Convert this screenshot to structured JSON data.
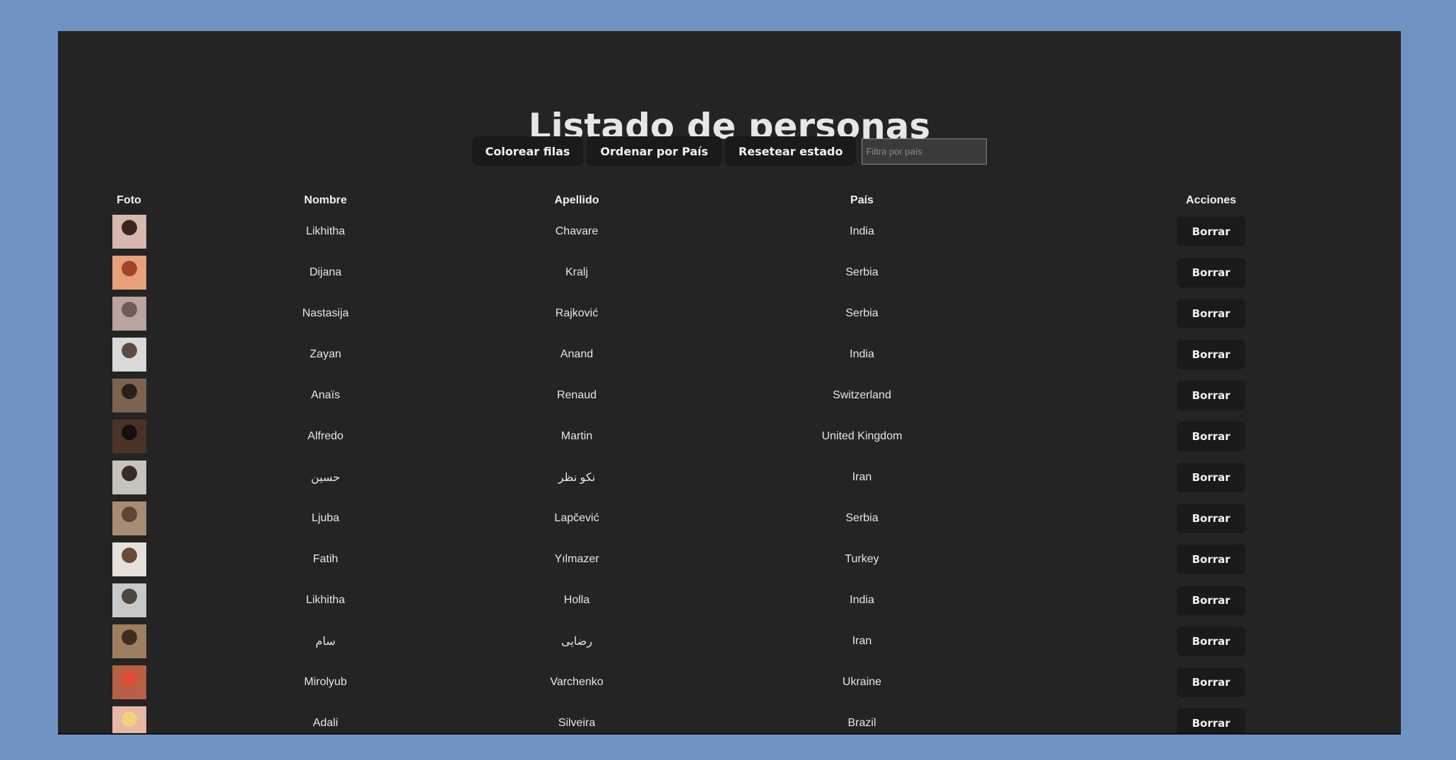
{
  "page": {
    "title": "Listado de personas"
  },
  "toolbar": {
    "color_rows_label": "Colorear filas",
    "sort_country_label": "Ordenar por País",
    "reset_label": "Resetear estado",
    "filter_placeholder": "Filtra por país"
  },
  "table": {
    "headers": [
      "Foto",
      "Nombre",
      "Apellido",
      "País",
      "Acciones"
    ],
    "delete_label": "Borrar",
    "rows": [
      {
        "first": "Likhitha",
        "last": "Chavare",
        "country": "India",
        "photo_colors": [
          "#d7b7ae",
          "#3a2520"
        ]
      },
      {
        "first": "Dijana",
        "last": "Kralj",
        "country": "Serbia",
        "photo_colors": [
          "#e8a07a",
          "#a0442c"
        ]
      },
      {
        "first": "Nastasija",
        "last": "Rajković",
        "country": "Serbia",
        "photo_colors": [
          "#b8a4a0",
          "#6e5c55"
        ]
      },
      {
        "first": "Zayan",
        "last": "Anand",
        "country": "India",
        "photo_colors": [
          "#d9d9d9",
          "#5a4a42"
        ]
      },
      {
        "first": "Anaïs",
        "last": "Renaud",
        "country": "Switzerland",
        "photo_colors": [
          "#7c6350",
          "#2b1f1a"
        ]
      },
      {
        "first": "Alfredo",
        "last": "Martin",
        "country": "United Kingdom",
        "photo_colors": [
          "#4a3326",
          "#151010"
        ]
      },
      {
        "first": "حسین",
        "last": "نکو نظر",
        "country": "Iran",
        "photo_colors": [
          "#c8c2bd",
          "#3b2c25"
        ]
      },
      {
        "first": "Ljuba",
        "last": "Lapčević",
        "country": "Serbia",
        "photo_colors": [
          "#a88b73",
          "#5b4536"
        ]
      },
      {
        "first": "Fatih",
        "last": "Yılmazer",
        "country": "Turkey",
        "photo_colors": [
          "#e5e0db",
          "#6b4a36"
        ]
      },
      {
        "first": "Likhitha",
        "last": "Holla",
        "country": "India",
        "photo_colors": [
          "#c7c9c9",
          "#4c4540"
        ]
      },
      {
        "first": "سام",
        "last": "رضایی",
        "country": "Iran",
        "photo_colors": [
          "#9d7f60",
          "#3e2c1f"
        ]
      },
      {
        "first": "Mirolyub",
        "last": "Varchenko",
        "country": "Ukraine",
        "photo_colors": [
          "#b85f45",
          "#e04b36"
        ]
      },
      {
        "first": "Adali",
        "last": "Silveira",
        "country": "Brazil",
        "photo_colors": [
          "#e8b8a4",
          "#f0d37a"
        ]
      }
    ]
  }
}
